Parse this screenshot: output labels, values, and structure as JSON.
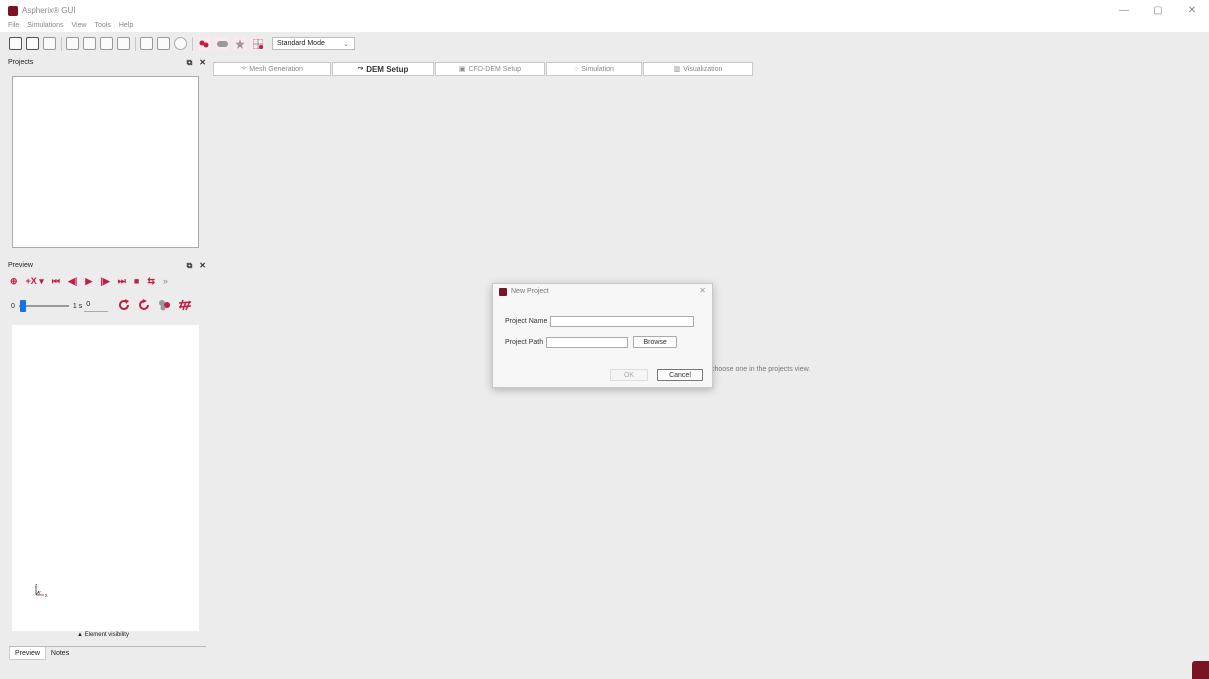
{
  "window": {
    "title": "Aspherix® GUI",
    "controls": {
      "minimize": "—",
      "restore": "▢",
      "close": "✕"
    },
    "accent_color": "#c21e45",
    "brand_color": "#7a1323"
  },
  "menu": [
    "File",
    "Simulations",
    "View",
    "Tools",
    "Help"
  ],
  "toolbar": {
    "mode_select": "Standard Mode",
    "dropdown_glyph": "⌄"
  },
  "projects_panel": {
    "title": "Projects",
    "float_glyph": "⧉",
    "close_glyph": "✕"
  },
  "preview_panel": {
    "title": "Preview",
    "float_glyph": "⧉",
    "close_glyph": "✕",
    "playback_glyphs": [
      "⊕",
      "+X ▾",
      "⏮",
      "◀|",
      "▶",
      "|▶",
      "⏭",
      "■",
      "⇆",
      "»"
    ],
    "slider_min_label": "0",
    "slider_max_label": "1 s",
    "time_value": "0",
    "slider_position": 0,
    "axis_labels": {
      "z": "z",
      "y": "y",
      "x": "x"
    },
    "element_visibility": "▲ Element visibility"
  },
  "bottom_tabs": [
    "Preview",
    "Notes"
  ],
  "wizard_steps": [
    {
      "label": "Mesh Generation",
      "glyph": "⟢"
    },
    {
      "label": "DEM Setup",
      "glyph": "⤳"
    },
    {
      "label": "CFD-DEM Setup",
      "glyph": "▣"
    },
    {
      "label": "Simulation",
      "glyph": "◌"
    },
    {
      "label": "Visualization",
      "glyph": "▥"
    }
  ],
  "main_hint": "choose one in the projects view.",
  "dialog": {
    "title": "New Project",
    "close_glyph": "✕",
    "project_name_label": "Project Name",
    "project_name_value": "",
    "project_path_label": "Project Path",
    "project_path_value": "",
    "browse_label": "Browse",
    "ok_label": "OK",
    "cancel_label": "Cancel"
  }
}
